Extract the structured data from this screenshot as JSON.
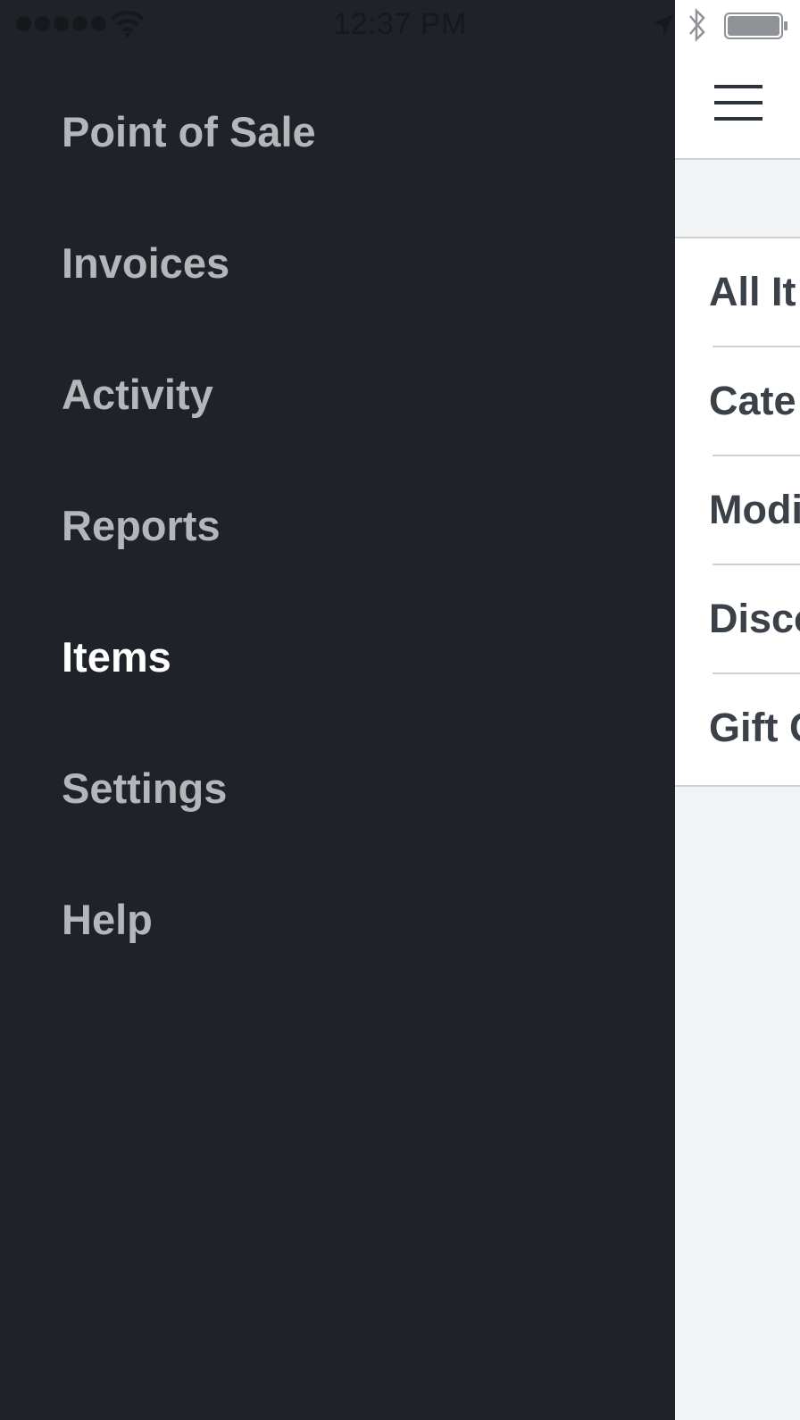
{
  "status_bar": {
    "time": "12:37 PM",
    "signal_icon": "signal-dots-icon",
    "wifi_icon": "wifi-icon",
    "location_icon": "location-arrow-icon",
    "bluetooth_icon": "bluetooth-icon",
    "battery_icon": "battery-icon"
  },
  "drawer": {
    "items": [
      {
        "label": "Point of Sale",
        "active": false
      },
      {
        "label": "Invoices",
        "active": false
      },
      {
        "label": "Activity",
        "active": false
      },
      {
        "label": "Reports",
        "active": false
      },
      {
        "label": "Items",
        "active": true
      },
      {
        "label": "Settings",
        "active": false
      },
      {
        "label": "Help",
        "active": false
      }
    ]
  },
  "main": {
    "menu_icon": "hamburger-menu-icon",
    "list": [
      {
        "label": "All It"
      },
      {
        "label": "Cate"
      },
      {
        "label": "Modi"
      },
      {
        "label": "Disco"
      },
      {
        "label": "Gift C"
      }
    ]
  },
  "colors": {
    "drawer_bg": "#1f2228",
    "drawer_text": "#b4b6ba",
    "drawer_active_text": "#ffffff",
    "list_text": "#3b4148",
    "panel_bg": "#f2f3f5"
  }
}
